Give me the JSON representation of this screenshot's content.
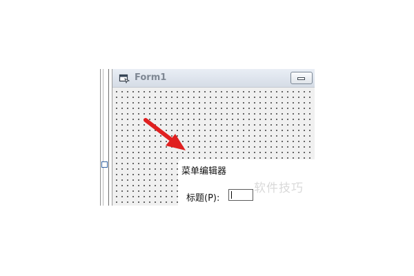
{
  "form_window": {
    "title": "Form1",
    "icon": "form-icon",
    "minimize_icon": "minimize-icon"
  },
  "menu_editor": {
    "title": "菜单编辑器",
    "caption_label": "标题(P):",
    "caption_value": ""
  },
  "watermark": {
    "text": "软件技巧"
  },
  "annotation": {
    "arrow_color": "#e02020"
  }
}
